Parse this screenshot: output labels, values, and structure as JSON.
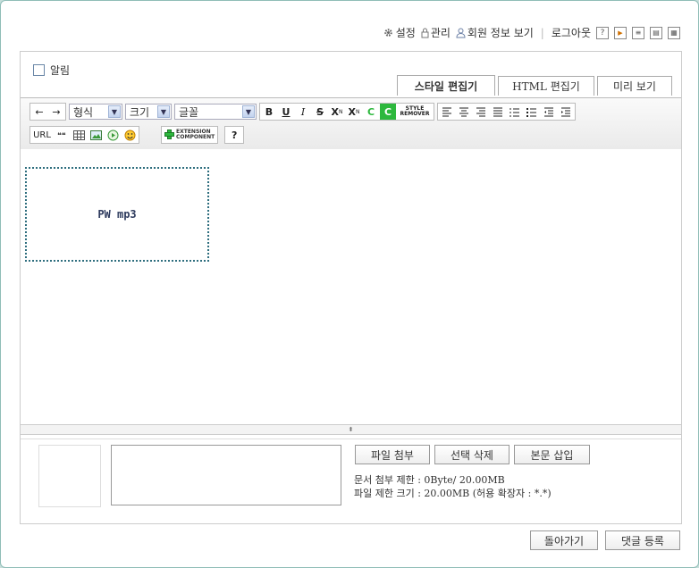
{
  "topnav": {
    "settings": "설정",
    "manage": "관리",
    "member_info": "회원 정보 보기",
    "logout": "로그아웃",
    "help_glyph": "?"
  },
  "form": {
    "alarm_label": "알림"
  },
  "tabs": [
    {
      "label": "스타일 편집기",
      "active": true
    },
    {
      "label": "HTML 편집기",
      "active": false
    },
    {
      "label": "미리 보기",
      "active": false
    }
  ],
  "toolbar": {
    "undo": "←",
    "redo": "→",
    "format_select": "형식",
    "size_select": "크기",
    "font_select": "글꼴",
    "bold": "B",
    "underline": "U",
    "italic": "I",
    "strike": "S",
    "sup": "X",
    "sup_mark": "N",
    "sub": "X",
    "sub_mark": "N",
    "fore_color": "C",
    "back_color": "C",
    "style_remover_1": "STYLE",
    "style_remover_2": "REMOVER",
    "url": "URL",
    "quote": "❝❝",
    "ext_1": "EXTENSION",
    "ext_2": "COMPONENT",
    "help": "?"
  },
  "editor": {
    "embed_text": "PW  mp3"
  },
  "attach": {
    "attach_button": "파일 첨부",
    "delete_button": "선택 삭제",
    "insert_button": "본문 삽입",
    "doc_limit": "문서 첨부 제한 : 0Byte/ 20.00MB",
    "file_limit": "파일 제한 크기 : 20.00MB (허용 확장자 : *.*)"
  },
  "bottom": {
    "back_button": "돌아가기",
    "submit_button": "댓글 등록"
  },
  "colors": {
    "frame_border": "#8fbdb7",
    "background": "#c7dedb",
    "embed_border": "#2e6e7e",
    "green": "#2db83d"
  }
}
